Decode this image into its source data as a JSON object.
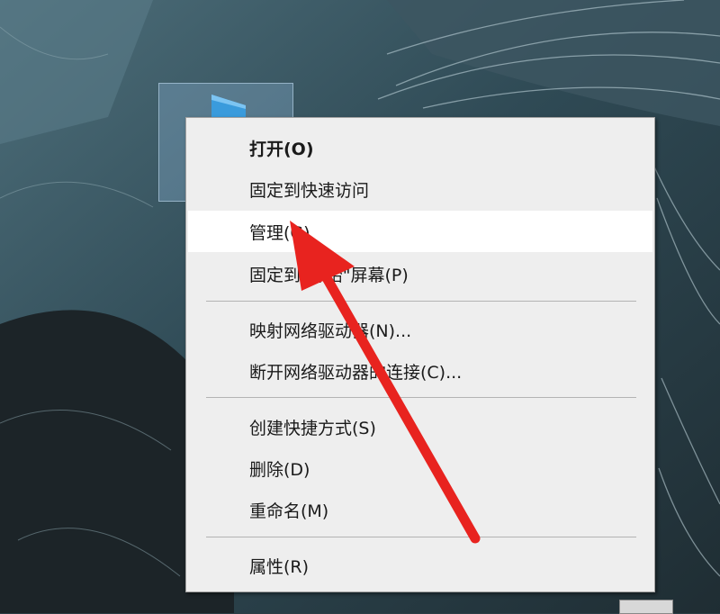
{
  "desktop": {
    "selected_icon": "this-pc-icon"
  },
  "context_menu": {
    "items": [
      {
        "label": "打开(O)",
        "bold": true
      },
      {
        "label": "固定到快速访问"
      },
      {
        "label": "管理(G)",
        "highlighted": true
      },
      {
        "label": "固定到\"开始\"屏幕(P)"
      },
      {
        "label": "映射网络驱动器(N)..."
      },
      {
        "label": "断开网络驱动器的连接(C)..."
      },
      {
        "label": "创建快捷方式(S)"
      },
      {
        "label": "删除(D)"
      },
      {
        "label": "重命名(M)"
      },
      {
        "label": "属性(R)"
      }
    ]
  },
  "annotation": {
    "arrow_color": "#e8231f",
    "points_to": "管理(G)"
  },
  "colors": {
    "menu_background": "#eeeeee",
    "highlight_background": "#ffffff",
    "wallpaper_base": "#2c3e46"
  }
}
